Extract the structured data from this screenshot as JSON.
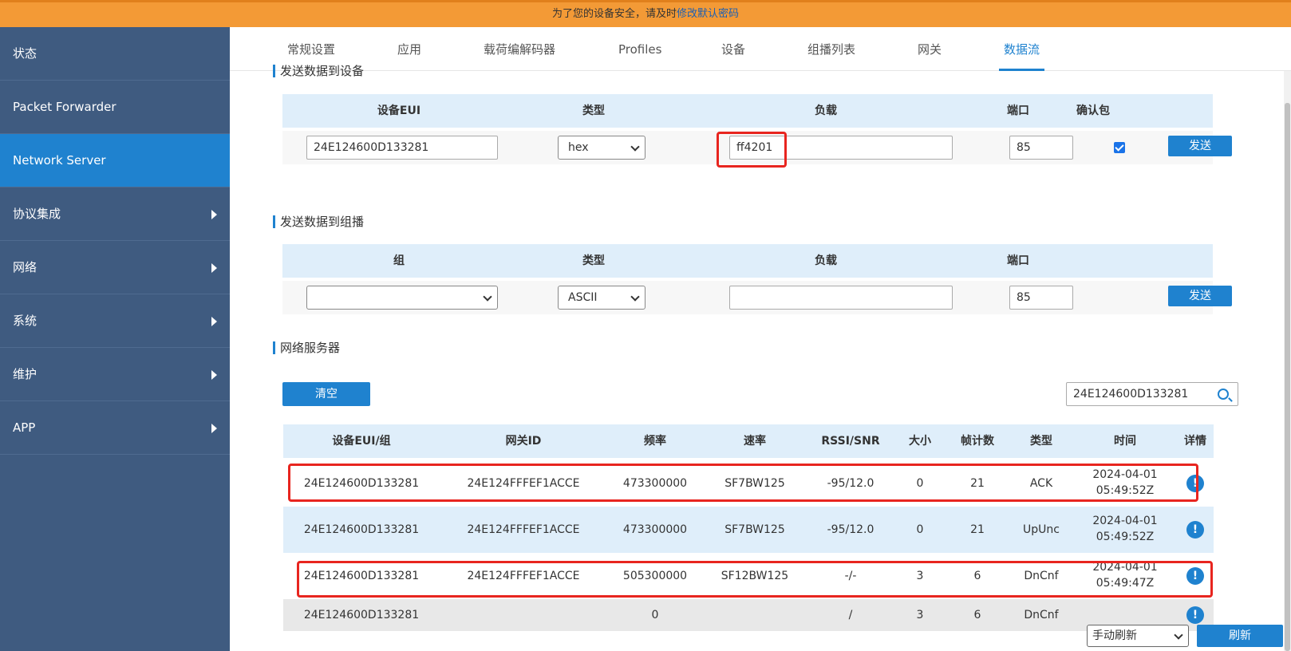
{
  "banner": {
    "text": "为了您的设备安全，请及时",
    "link": "修改默认密码"
  },
  "sidebar": {
    "items": [
      {
        "label": "状态"
      },
      {
        "label": "Packet Forwarder"
      },
      {
        "label": "Network Server"
      },
      {
        "label": "协议集成"
      },
      {
        "label": "网络"
      },
      {
        "label": "系统"
      },
      {
        "label": "维护"
      },
      {
        "label": "APP"
      }
    ]
  },
  "tabs": [
    {
      "label": "常规设置"
    },
    {
      "label": "应用"
    },
    {
      "label": "载荷编解码器"
    },
    {
      "label": "Profiles"
    },
    {
      "label": "设备"
    },
    {
      "label": "组播列表"
    },
    {
      "label": "网关"
    },
    {
      "label": "数据流"
    }
  ],
  "send_device": {
    "title": "发送数据到设备",
    "headers": {
      "eui": "设备EUI",
      "type": "类型",
      "payload": "负载",
      "port": "端口",
      "confirm": "确认包"
    },
    "eui_value": "24E124600D133281",
    "type_value": "hex",
    "payload_value": "ff4201",
    "port_value": "85",
    "send_label": "发送"
  },
  "send_group": {
    "title": "发送数据到组播",
    "headers": {
      "group": "组",
      "type": "类型",
      "payload": "负载",
      "port": "端口"
    },
    "group_value": "",
    "type_value": "ASCII",
    "payload_value": "",
    "port_value": "85",
    "send_label": "发送"
  },
  "network_server": {
    "title": "网络服务器",
    "clear_label": "清空",
    "search_value": "24E124600D133281",
    "headers": {
      "eui": "设备EUI/组",
      "gateway": "网关ID",
      "freq": "频率",
      "rate": "速率",
      "rssi": "RSSI/SNR",
      "size": "大小",
      "fcnt": "帧计数",
      "type": "类型",
      "time": "时间",
      "detail": "详情"
    },
    "rows": [
      {
        "eui": "24E124600D133281",
        "gateway": "24E124FFFEF1ACCE",
        "freq": "473300000",
        "rate": "SF7BW125",
        "rssi": "-95/12.0",
        "size": "0",
        "fcnt": "21",
        "type": "ACK",
        "date": "2024-04-01",
        "time": "05:49:52Z"
      },
      {
        "eui": "24E124600D133281",
        "gateway": "24E124FFFEF1ACCE",
        "freq": "473300000",
        "rate": "SF7BW125",
        "rssi": "-95/12.0",
        "size": "0",
        "fcnt": "21",
        "type": "UpUnc",
        "date": "2024-04-01",
        "time": "05:49:52Z"
      },
      {
        "eui": "24E124600D133281",
        "gateway": "24E124FFFEF1ACCE",
        "freq": "505300000",
        "rate": "SF12BW125",
        "rssi": "-/-",
        "size": "3",
        "fcnt": "6",
        "type": "DnCnf",
        "date": "2024-04-01",
        "time": "05:49:47Z"
      },
      {
        "eui": "24E124600D133281",
        "gateway": "",
        "freq": "0",
        "rate": "",
        "rssi": "/",
        "size": "3",
        "fcnt": "6",
        "type": "DnCnf",
        "date": "",
        "time": ""
      }
    ],
    "info_glyph": "!"
  },
  "footer": {
    "refresh_mode": "手动刷新",
    "refresh_label": "刷新"
  }
}
